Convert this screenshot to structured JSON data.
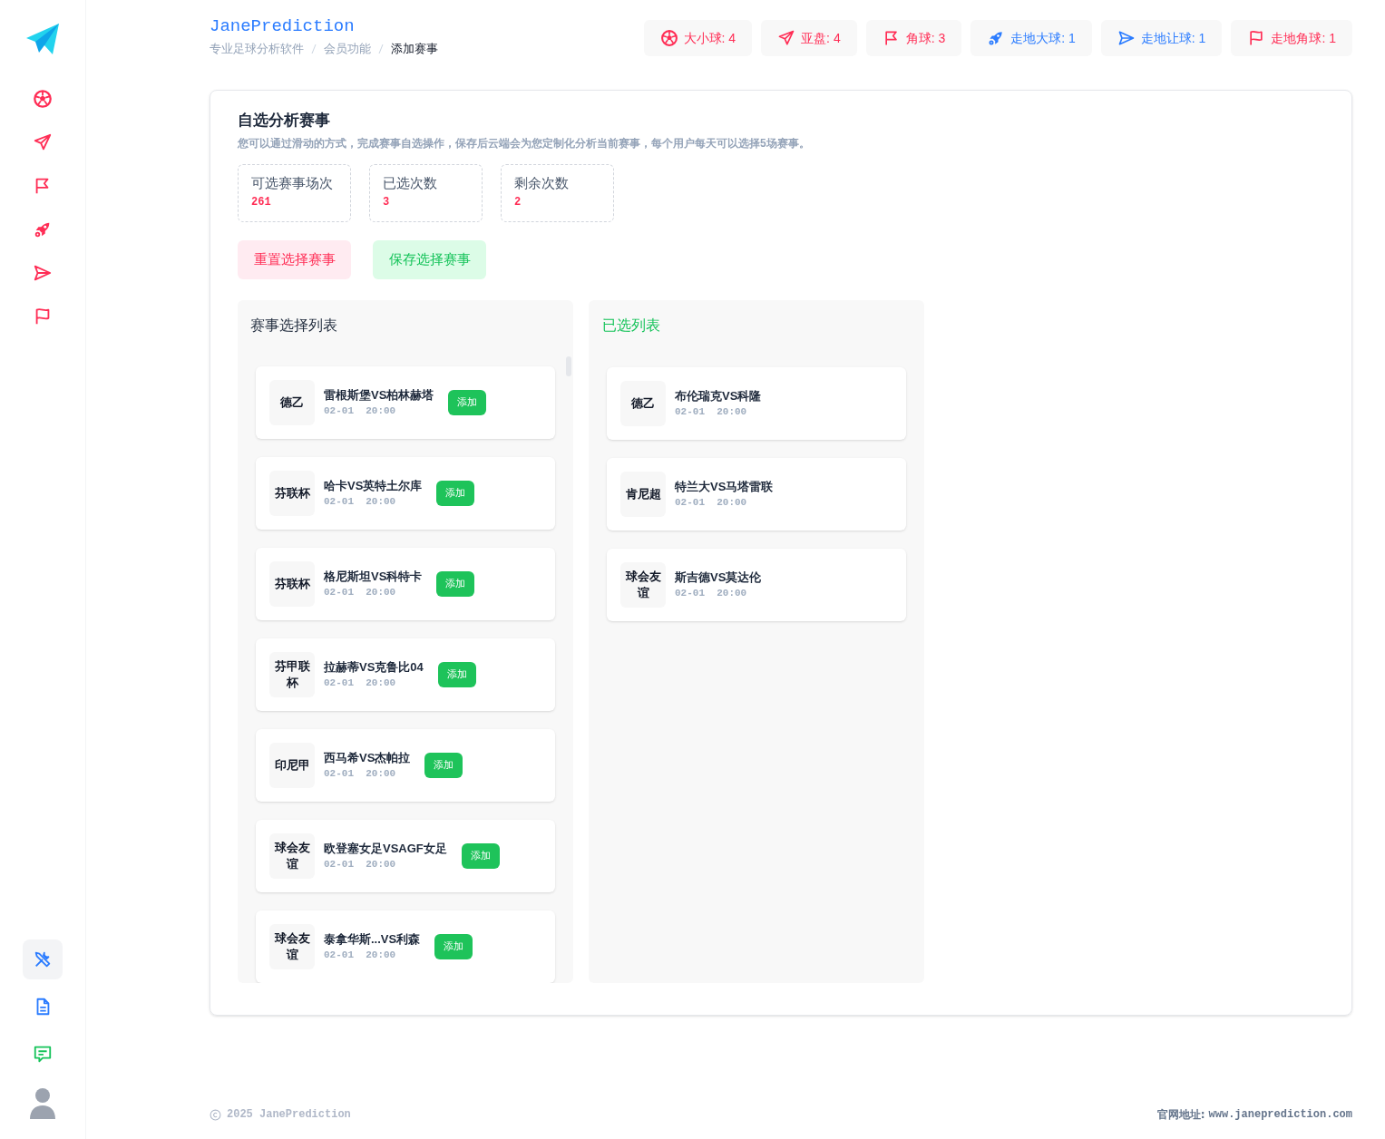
{
  "sidebar": {
    "nav": [
      {
        "kind": "ball"
      },
      {
        "kind": "plane"
      },
      {
        "kind": "flag"
      },
      {
        "kind": "rocket"
      },
      {
        "kind": "send"
      },
      {
        "kind": "banner"
      }
    ],
    "tools": [
      {
        "kind": "tools",
        "selected": true
      },
      {
        "kind": "doc",
        "selected": false
      },
      {
        "kind": "chat",
        "selected": false
      }
    ]
  },
  "header": {
    "title": "JanePrediction",
    "breadcrumb": [
      "专业足球分析软件",
      "会员功能",
      "添加赛事"
    ]
  },
  "chips": [
    {
      "kind": "ball",
      "label": "大小球: 4",
      "color": "#ff2d55"
    },
    {
      "kind": "plane",
      "label": "亚盘: 4",
      "color": "#ff2d55"
    },
    {
      "kind": "flag",
      "label": "角球: 3",
      "color": "#ff2d55"
    },
    {
      "kind": "rocket",
      "label": "走地大球: 1",
      "color": "#2b7cff"
    },
    {
      "kind": "send",
      "label": "走地让球: 1",
      "color": "#2b7cff"
    },
    {
      "kind": "banner",
      "label": "走地角球: 1",
      "color": "#ff2d55"
    }
  ],
  "panel": {
    "title": "自选分析赛事",
    "description": "您可以通过滑动的方式，完成赛事自选操作，保存后云端会为您定制化分析当前赛事，每个用户每天可以选择5场赛事。",
    "stats": [
      {
        "label": "可选赛事场次",
        "value": "261"
      },
      {
        "label": "已选次数",
        "value": "3"
      },
      {
        "label": "剩余次数",
        "value": "2"
      }
    ],
    "buttons": [
      {
        "kind": "reset",
        "label": "重置选择赛事"
      },
      {
        "kind": "save",
        "label": "保存选择赛事"
      }
    ],
    "match_list": {
      "title": "赛事选择列表",
      "items": [
        {
          "league": "德乙",
          "teams": "雷根斯堡VS柏林赫塔",
          "time": "02-01  20:00",
          "action": "添加"
        },
        {
          "league": "芬联杯",
          "teams": "哈卡VS英特土尔库",
          "time": "02-01  20:00",
          "action": "添加"
        },
        {
          "league": "芬联杯",
          "teams": "格尼斯坦VS科特卡",
          "time": "02-01  20:00",
          "action": "添加"
        },
        {
          "league": "芬甲联杯",
          "teams": "拉赫蒂VS克鲁比04",
          "time": "02-01  20:00",
          "action": "添加"
        },
        {
          "league": "印尼甲",
          "teams": "西马希VS杰帕拉",
          "time": "02-01  20:00",
          "action": "添加"
        },
        {
          "league": "球会友谊",
          "teams": "欧登塞女足VSAGF女足",
          "time": "02-01  20:00",
          "action": "添加"
        },
        {
          "league": "球会友谊",
          "teams": "泰拿华斯...VS利森",
          "time": "02-01  20:00",
          "action": "添加"
        }
      ]
    },
    "selected_list": {
      "title": "已选列表",
      "items": [
        {
          "league": "德乙",
          "teams": "布伦瑞克VS科隆",
          "time": "02-01  20:00"
        },
        {
          "league": "肯尼超",
          "teams": "特兰大VS马塔雷联",
          "time": "02-01  20:00"
        },
        {
          "league": "球会友谊",
          "teams": "斯吉德VS莫达伦",
          "time": "02-01  20:00"
        }
      ]
    }
  },
  "footer": {
    "copyright": "2025 JanePrediction",
    "site_label": "官网地址:",
    "site": "www.janeprediction.com"
  }
}
